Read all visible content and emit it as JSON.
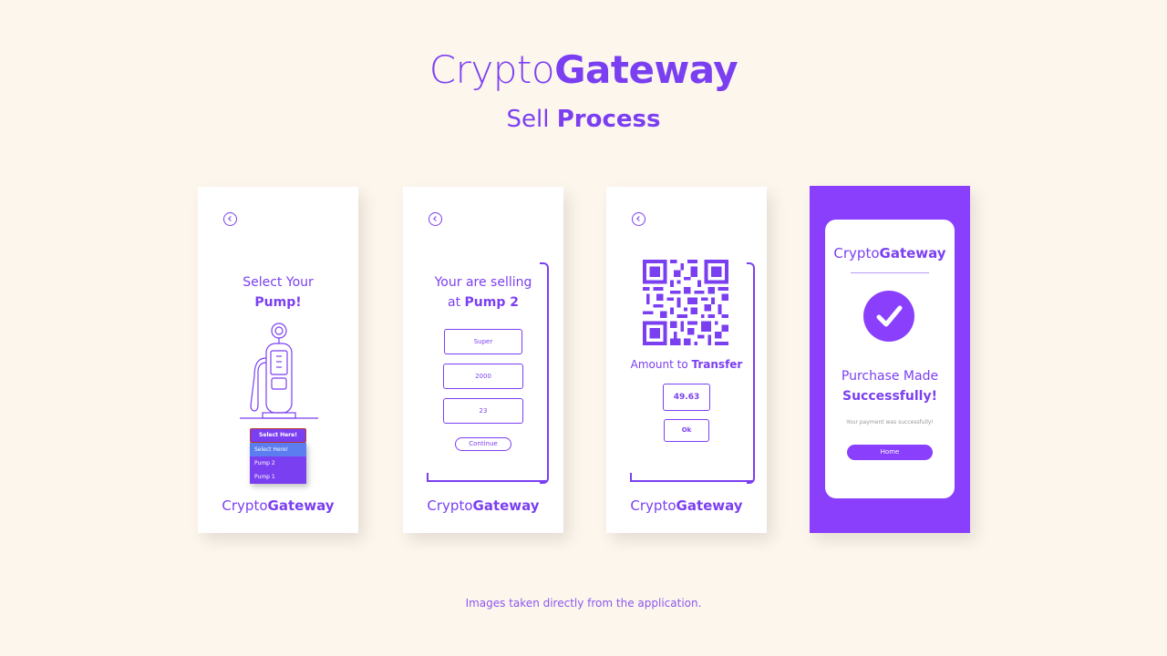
{
  "header": {
    "title_light": "Crypto",
    "title_bold": "Gateway",
    "subtitle_light": "Sell",
    "subtitle_bold": "Process"
  },
  "footnote": "Images taken directly from the application.",
  "brand": {
    "light": "Crypto",
    "bold": "Gateway"
  },
  "screen1": {
    "heading_line1": "Select Your",
    "heading_line2": "Pump!",
    "select_label": "Select Here!",
    "options": [
      "Select Here!",
      "Pump 2",
      "Pump 1"
    ]
  },
  "screen2": {
    "heading_line1": "Your are selling",
    "heading_line2_prefix": "at",
    "heading_line2_bold": "Pump 2",
    "field1": "Super",
    "field2": "2000",
    "field3": "23",
    "continue_label": "Continue"
  },
  "screen3": {
    "amount_prefix": "Amount to",
    "amount_bold": "Transfer",
    "amount_value": "49.63",
    "ok_label": "Ok"
  },
  "screen4": {
    "message_line1": "Purchase Made",
    "message_line2": "Successfully!",
    "detail": "Your payment was successfully!",
    "home_label": "Home"
  },
  "colors": {
    "accent": "#7b3ff2",
    "background": "#fdf6ec",
    "success_panel": "#8a3ffc"
  }
}
